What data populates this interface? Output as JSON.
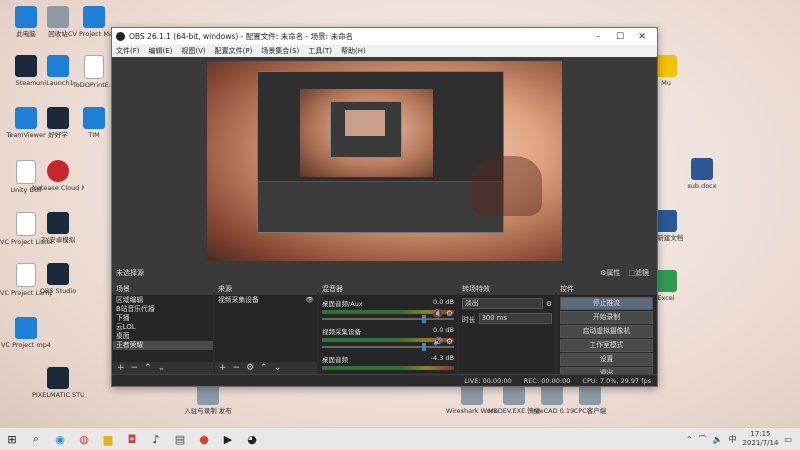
{
  "desktop": {
    "icons": [
      {
        "label": "此电脑",
        "kind": "blue"
      },
      {
        "label": "回收站",
        "kind": "gray"
      },
      {
        "label": "CV Project Manager",
        "kind": "blue"
      },
      {
        "label": "Steam",
        "kind": "dark"
      },
      {
        "label": "uniLaunch1...",
        "kind": "blue"
      },
      {
        "label": "ToDOPrintE...",
        "kind": "doc"
      },
      {
        "label": "TeamViewer",
        "kind": "blue"
      },
      {
        "label": "好好学",
        "kind": "dark"
      },
      {
        "label": "TIM",
        "kind": "blue"
      },
      {
        "label": "Unity Bull",
        "kind": "doc"
      },
      {
        "label": "Netease Cloud Music",
        "kind": "red"
      },
      {
        "label": "VC Project Listeners",
        "kind": "doc"
      },
      {
        "label": "ZY安卓模拟",
        "kind": "dark"
      },
      {
        "label": "VC Project Lamp",
        "kind": "doc"
      },
      {
        "label": "OBS Studio",
        "kind": "dark"
      },
      {
        "label": "VC Project mp4",
        "kind": "blue"
      },
      {
        "label": "PIXELMATIC STUDIO",
        "kind": "dark"
      },
      {
        "label": "入驻与录制 发布",
        "kind": "gray"
      },
      {
        "label": "Wireshark Workstation",
        "kind": "gray"
      },
      {
        "label": "MSDEV.EXE 快捷方式",
        "kind": "gray"
      },
      {
        "label": "FreeCAD 0.19",
        "kind": "gray"
      },
      {
        "label": "CPC客户端",
        "kind": "gray"
      },
      {
        "label": "Mu",
        "kind": "yellow"
      },
      {
        "label": "sub.docx",
        "kind": "word"
      },
      {
        "label": "W 新建文档",
        "kind": "word"
      },
      {
        "label": "Excel",
        "kind": "green"
      }
    ]
  },
  "obs": {
    "title": "OBS 26.1.1 (64-bit, windows) - 配置文件: 未命名 - 场景: 未命名",
    "menu": [
      "文件(F)",
      "编辑(E)",
      "视图(V)",
      "配置文件(P)",
      "场景集合(S)",
      "工具(T)",
      "帮助(H)"
    ],
    "scene_label": "未选择源",
    "props_label": "⚙属性",
    "filters_label": "⬚滤镜",
    "scenes": {
      "header": "场景",
      "items": [
        "区域编辑",
        "B站音乐代播",
        "下播",
        "云LOL",
        "桌面",
        "王者荣耀"
      ],
      "selected_index": 5
    },
    "sources": {
      "header": "来源",
      "items": [
        "视频采集设备"
      ]
    },
    "mixer": {
      "header": "混音器",
      "channels": [
        {
          "name": "桌面音频/Aux",
          "db": "0.0 dB",
          "muted": true
        },
        {
          "name": "视频采集设备",
          "db": "0.0 dB",
          "muted": false
        },
        {
          "name": "桌面音频",
          "db": "-4.3 dB",
          "muted": false
        }
      ]
    },
    "transitions": {
      "header": "转场特效",
      "type": "淡出",
      "duration_label": "时长",
      "duration": "300 ms"
    },
    "controls": {
      "header": "控件",
      "buttons": [
        "停止推流",
        "开始录制",
        "启动虚拟摄像机",
        "工作室模式",
        "设置",
        "退出"
      ],
      "active_index": 0
    },
    "status": {
      "live": "LIVE: 00:00:00",
      "rec": "REC: 00:00:00",
      "cpu": "CPU: 7.0%, 29.97 fps"
    }
  },
  "taskbar": {
    "time": "17:15",
    "date": "2021/7/14",
    "lang": "中"
  }
}
